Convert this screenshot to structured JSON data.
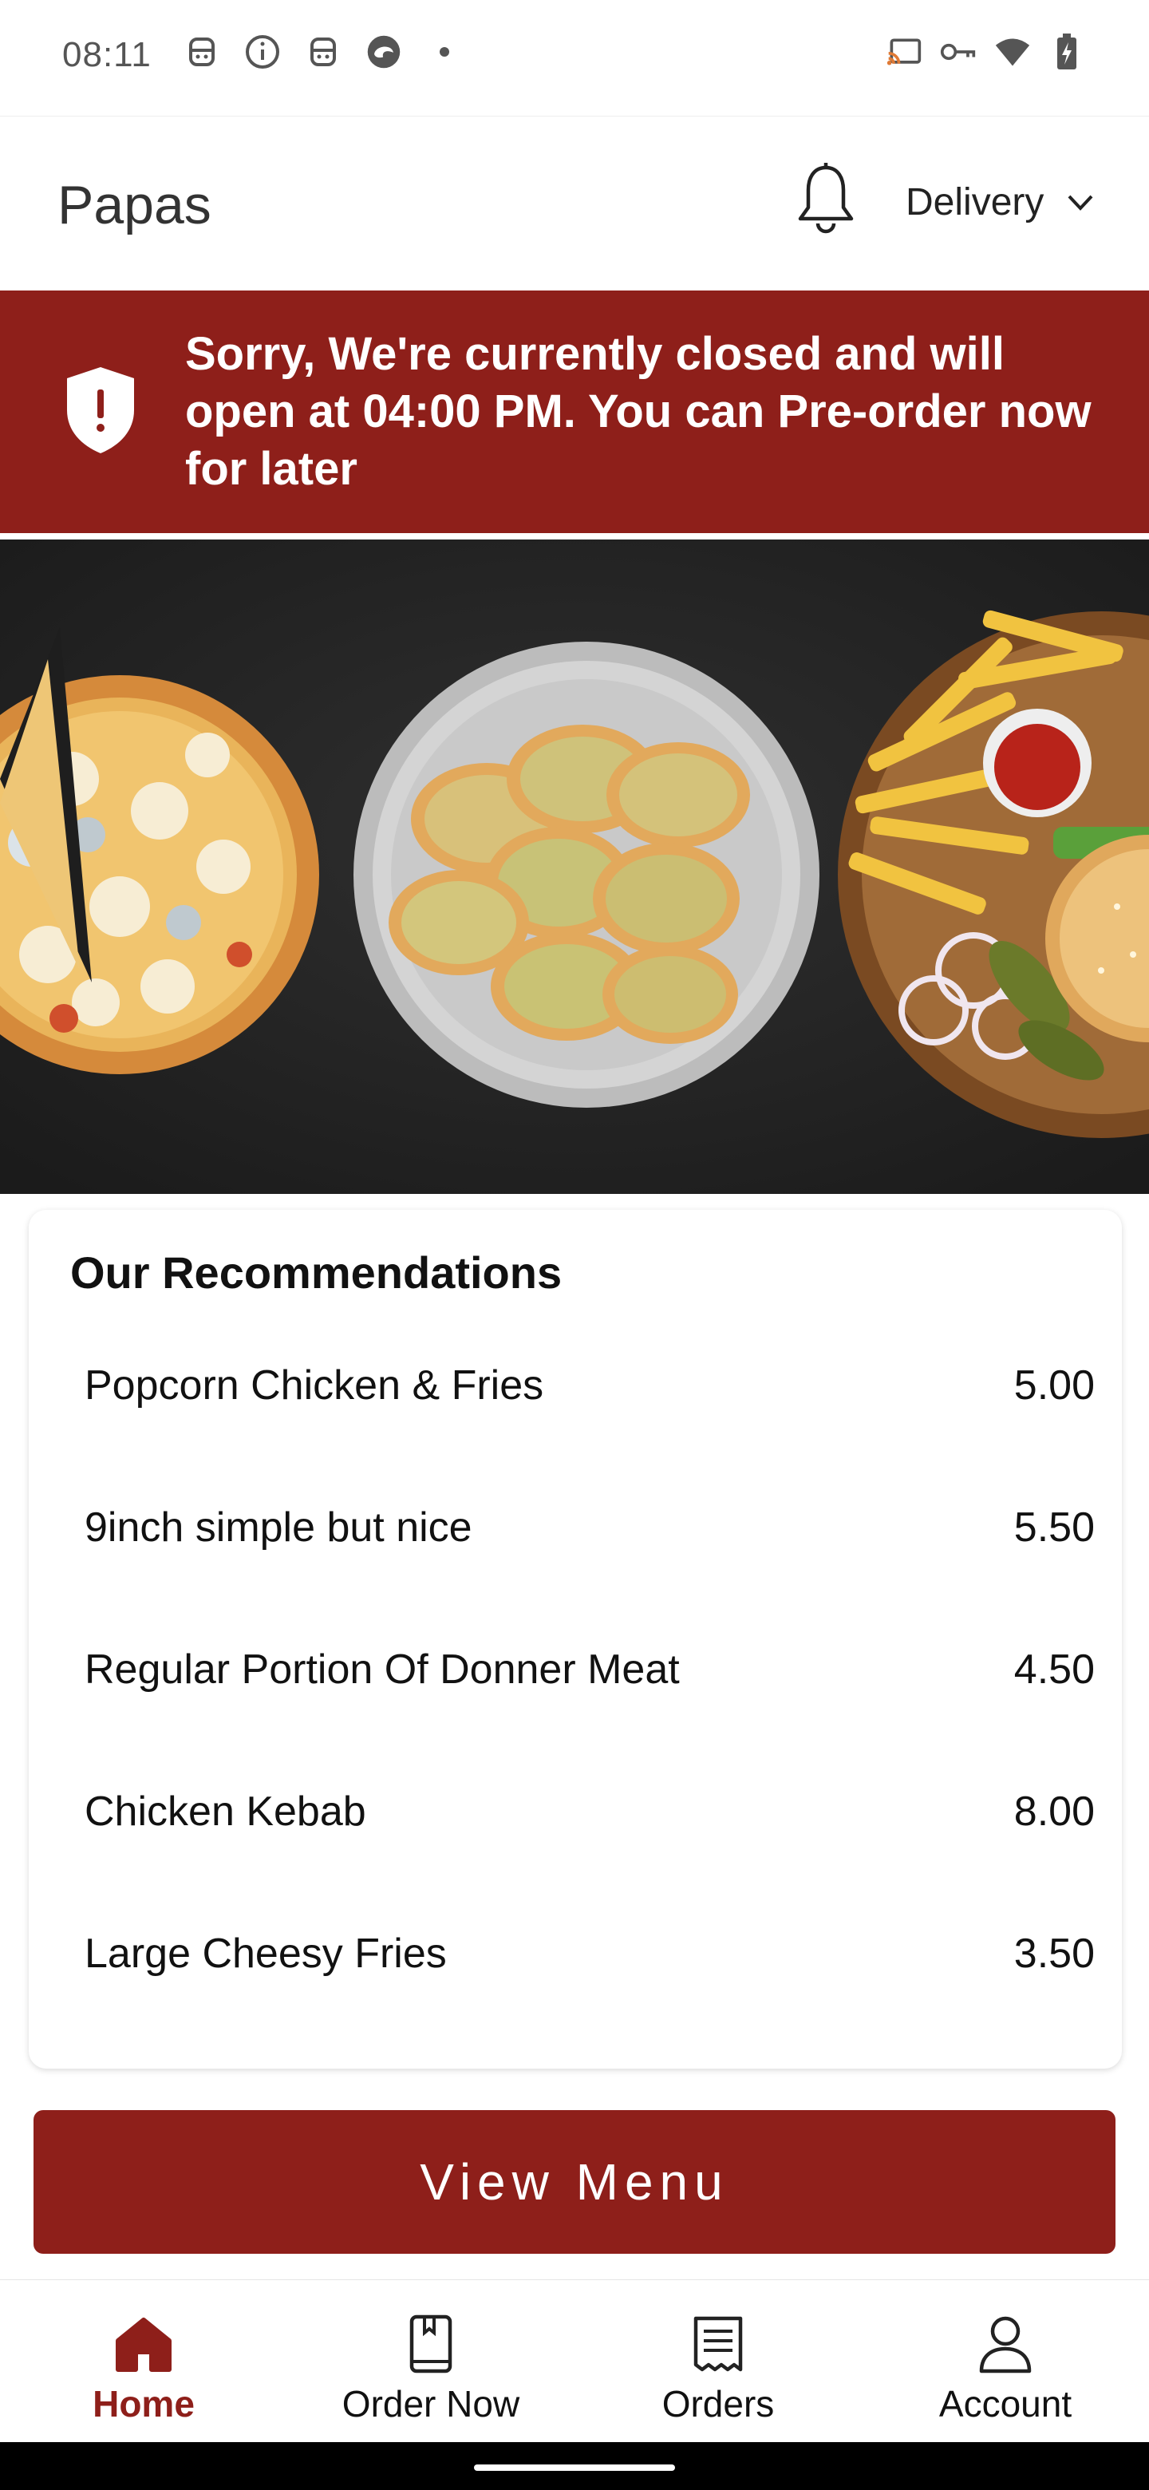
{
  "status_bar": {
    "time": "08:11",
    "left_icons": [
      "notification-face-icon",
      "info-icon",
      "notification-face-icon",
      "edge-browser-icon",
      "dot-icon"
    ],
    "right_icons": [
      "cast-icon",
      "vpn-key-icon",
      "wifi-icon",
      "battery-charging-icon"
    ]
  },
  "header": {
    "title": "Papas",
    "delivery_label": "Delivery"
  },
  "closed_banner": {
    "message": "Sorry, We're currently closed and will open at 04:00 PM. You can Pre-order now for later",
    "background": "#8e1f1a"
  },
  "hero": {
    "description_icons": [
      "pizza-image",
      "garlic-bread-image",
      "burger-fries-image"
    ]
  },
  "recommendations": {
    "title": "Our Recommendations",
    "items": [
      {
        "name": "Popcorn Chicken & Fries",
        "price": "5.00"
      },
      {
        "name": "9inch simple but nice",
        "price": "5.50"
      },
      {
        "name": "Regular Portion Of Donner Meat",
        "price": "4.50"
      },
      {
        "name": "Chicken Kebab",
        "price": "8.00"
      },
      {
        "name": "Large Cheesy Fries",
        "price": "3.50"
      }
    ]
  },
  "view_menu": {
    "label": "View Menu",
    "color": "#8e1f1a"
  },
  "bottom_nav": {
    "items": [
      {
        "label": "Home",
        "icon": "home-icon",
        "active": true
      },
      {
        "label": "Order Now",
        "icon": "order-book-icon",
        "active": false
      },
      {
        "label": "Orders",
        "icon": "receipt-icon",
        "active": false
      },
      {
        "label": "Account",
        "icon": "account-icon",
        "active": false
      }
    ],
    "active_color": "#8e1f1a"
  }
}
